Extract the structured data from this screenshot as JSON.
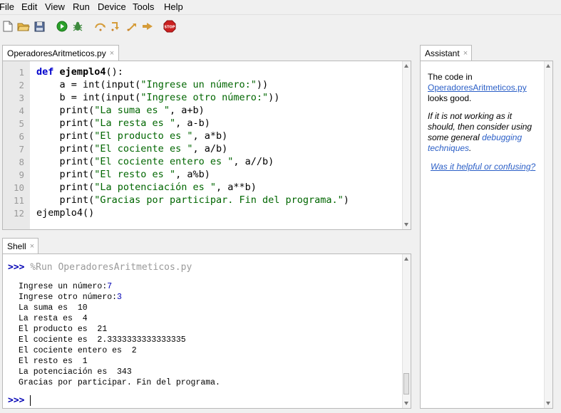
{
  "menu": [
    "File",
    "Edit",
    "View",
    "Run",
    "Device",
    "Tools",
    "Help"
  ],
  "editor": {
    "tab_label": "OperadoresAritmeticos.py",
    "lines": [
      {
        "n": "1",
        "parts": [
          {
            "t": "def ",
            "c": "kw"
          },
          {
            "t": "ejemplo4",
            "c": "fn"
          },
          {
            "t": "():",
            "c": ""
          }
        ]
      },
      {
        "n": "2",
        "parts": [
          {
            "t": "    a = int(input(",
            "c": ""
          },
          {
            "t": "\"Ingrese un número:\"",
            "c": "str"
          },
          {
            "t": "))",
            "c": ""
          }
        ]
      },
      {
        "n": "3",
        "parts": [
          {
            "t": "    b = int(input(",
            "c": ""
          },
          {
            "t": "\"Ingrese otro número:\"",
            "c": "str"
          },
          {
            "t": "))",
            "c": ""
          }
        ]
      },
      {
        "n": "4",
        "parts": [
          {
            "t": "    print(",
            "c": "str"
          },
          {
            "t": "\"La suma es \"",
            "c": "str"
          },
          {
            "t": ", a+b)",
            "c": ""
          }
        ]
      },
      {
        "n": "5",
        "parts": [
          {
            "t": "    print(",
            "c": "str"
          },
          {
            "t": "\"La resta es \"",
            "c": "str"
          },
          {
            "t": ", a-b)",
            "c": ""
          }
        ]
      },
      {
        "n": "6",
        "parts": [
          {
            "t": "    print(",
            "c": "str"
          },
          {
            "t": "\"El producto es \"",
            "c": "str"
          },
          {
            "t": ", a*b)",
            "c": ""
          }
        ]
      },
      {
        "n": "7",
        "parts": [
          {
            "t": "    print(",
            "c": "str"
          },
          {
            "t": "\"El cociente es \"",
            "c": "str"
          },
          {
            "t": ", a/b)",
            "c": ""
          }
        ]
      },
      {
        "n": "8",
        "parts": [
          {
            "t": "    print(",
            "c": "str"
          },
          {
            "t": "\"El cociente entero es \"",
            "c": "str"
          },
          {
            "t": ", a//b)",
            "c": ""
          }
        ]
      },
      {
        "n": "9",
        "parts": [
          {
            "t": "    print(",
            "c": "str"
          },
          {
            "t": "\"El resto es \"",
            "c": "str"
          },
          {
            "t": ", a%b)",
            "c": ""
          }
        ]
      },
      {
        "n": "10",
        "parts": [
          {
            "t": "    print(",
            "c": "str"
          },
          {
            "t": "\"La potenciación es \"",
            "c": "str"
          },
          {
            "t": ", a**b)",
            "c": ""
          }
        ]
      },
      {
        "n": "11",
        "parts": [
          {
            "t": "    print(",
            "c": "str"
          },
          {
            "t": "\"Gracias por participar. Fin del programa.\"",
            "c": "str"
          },
          {
            "t": ")",
            "c": ""
          }
        ]
      },
      {
        "n": "12",
        "parts": [
          {
            "t": "ejemplo4()",
            "c": ""
          }
        ]
      }
    ]
  },
  "shell": {
    "tab_label": "Shell",
    "prompt": ">>>",
    "run_command": "%Run OperadoresAritmeticos.py",
    "output": [
      {
        "text": "Ingrese un número:",
        "input": "7"
      },
      {
        "text": "Ingrese otro número:",
        "input": "3"
      },
      {
        "text": "La suma es  10",
        "input": ""
      },
      {
        "text": "La resta es  4",
        "input": ""
      },
      {
        "text": "El producto es  21",
        "input": ""
      },
      {
        "text": "El cociente es  2.3333333333333335",
        "input": ""
      },
      {
        "text": "El cociente entero es  2",
        "input": ""
      },
      {
        "text": "El resto es  1",
        "input": ""
      },
      {
        "text": "La potenciación es  343",
        "input": ""
      },
      {
        "text": "Gracias por participar. Fin del programa.",
        "input": ""
      }
    ]
  },
  "assistant": {
    "tab_label": "Assistant",
    "msg_prefix": "The code in",
    "file_link": "OperadoresAritmeticos.py",
    "msg_suffix": "looks good.",
    "hint_1": "If it is not working as it",
    "hint_2": "should, then consider using",
    "hint_3": "some general",
    "hint_link_1": "debugging",
    "hint_link_2": "techniques",
    "hint_end": ".",
    "feedback_link": "Was it helpful or confusing?"
  },
  "tab_close_glyph": "×",
  "icons": [
    "new-file-icon",
    "open-folder-icon",
    "save-icon",
    "run-icon",
    "debug-icon",
    "step-over-icon",
    "step-into-icon",
    "step-out-icon",
    "resume-icon",
    "stop-icon"
  ]
}
